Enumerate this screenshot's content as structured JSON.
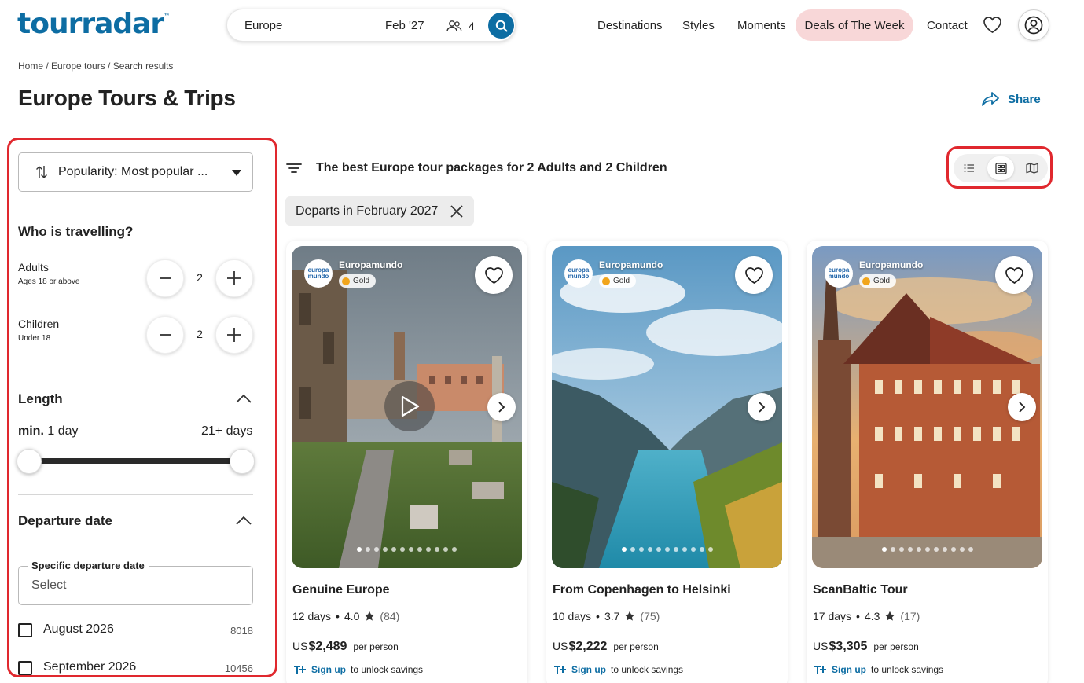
{
  "header": {
    "logo_text": "tourradar",
    "logo_tm": "™",
    "search": {
      "destination": "Europe",
      "date": "Feb '27",
      "travellers": "4"
    },
    "nav": [
      "Destinations",
      "Styles",
      "Moments",
      "Deals of The Week",
      "Contact"
    ],
    "brand_color": "#0d6da3",
    "deals_bg": "#f8d7d8"
  },
  "breadcrumb": "Home / Europe tours / Search results",
  "page_title": "Europe Tours & Trips",
  "share_label": "Share",
  "sidebar": {
    "sort_label": "Popularity: Most popular ...",
    "travellers_heading": "Who is travelling?",
    "adults": {
      "label": "Adults",
      "sub": "Ages 18 or above",
      "value": "2"
    },
    "children": {
      "label": "Children",
      "sub": "Under 18",
      "value": "2"
    },
    "length": {
      "heading": "Length",
      "min_prefix": "min.",
      "min_value": "1 day",
      "max_value": "21+ days",
      "min_days": 1,
      "max_days": 21
    },
    "departure": {
      "heading": "Departure date",
      "specific_label": "Specific departure date",
      "placeholder": "Select",
      "months": [
        {
          "name": "August 2026",
          "count": "8018"
        },
        {
          "name": "September 2026",
          "count": "10456"
        }
      ]
    }
  },
  "results": {
    "heading": "The best Europe tour packages for 2 Adults and 2 Children",
    "chip": "Departs in February 2027",
    "view_modes": [
      "list-view-icon",
      "grid-view-icon",
      "map-view-icon"
    ],
    "active_view": "grid"
  },
  "tours": [
    {
      "operator": "Europamundo",
      "badge": "Gold",
      "title": "Genuine Europe",
      "days": "12 days",
      "rating": "4.0",
      "reviews": "(84)",
      "currency": "US",
      "price": "$2,489",
      "per": "per person",
      "signup": "Sign up",
      "signup_rest": "to unlock savings",
      "has_video": true
    },
    {
      "operator": "Europamundo",
      "badge": "Gold",
      "title": "From Copenhagen to Helsinki",
      "days": "10 days",
      "rating": "3.7",
      "reviews": "(75)",
      "currency": "US",
      "price": "$2,222",
      "per": "per person",
      "signup": "Sign up",
      "signup_rest": "to unlock savings",
      "has_video": false
    },
    {
      "operator": "Europamundo",
      "badge": "Gold",
      "title": "ScanBaltic Tour",
      "days": "17 days",
      "rating": "4.3",
      "reviews": "(17)",
      "currency": "US",
      "price": "$3,305",
      "per": "per person",
      "signup": "Sign up",
      "signup_rest": "to unlock savings",
      "has_video": false
    }
  ],
  "annotation_color": "#e0282e"
}
